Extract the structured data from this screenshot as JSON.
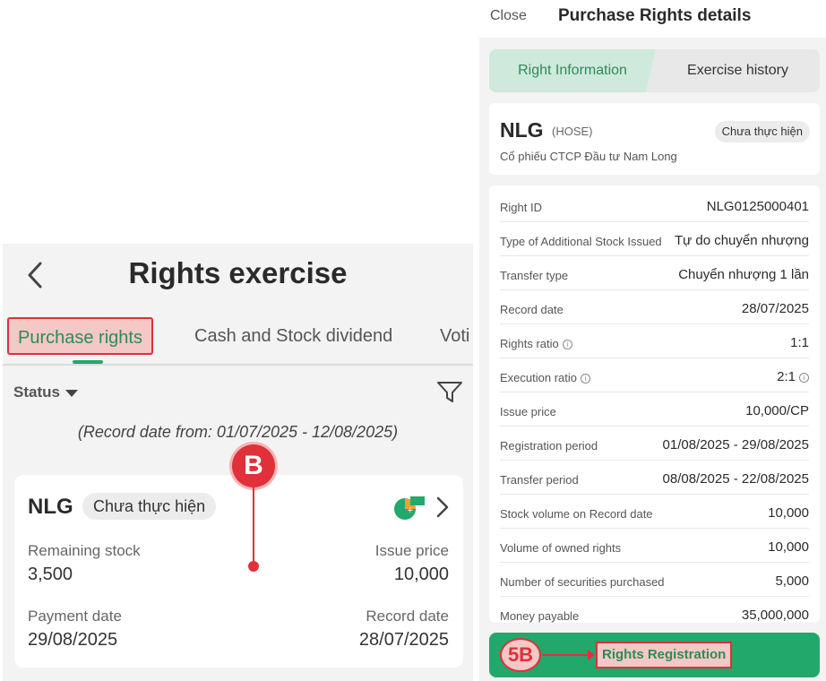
{
  "left": {
    "title": "Rights exercise",
    "back_icon": "chevron-left-icon",
    "tabs": [
      {
        "label": "Purchase rights",
        "active": true
      },
      {
        "label": "Cash and Stock dividend",
        "active": false
      },
      {
        "label": "Voti",
        "active": false
      }
    ],
    "status_label": "Status",
    "filter_icon": "filter-icon",
    "record_date_range": "(Record date from: 01/07/2025 - 12/08/2025)",
    "callout": "B",
    "card": {
      "code": "NLG",
      "status": "Chưa thực hiện",
      "remaining_stock_label": "Remaining stock",
      "remaining_stock_value": "3,500",
      "issue_price_label": "Issue price",
      "issue_price_value": "10,000",
      "payment_date_label": "Payment date",
      "payment_date_value": "29/08/2025",
      "record_date_label": "Record date",
      "record_date_value": "28/07/2025"
    },
    "colors": {
      "accent": "#24a86b",
      "highlight": "#e0303a"
    }
  },
  "right": {
    "close_label": "Close",
    "title": "Purchase Rights details",
    "segments": [
      {
        "label": "Right Information",
        "active": true
      },
      {
        "label": "Exercise history",
        "active": false
      }
    ],
    "stock": {
      "code": "NLG",
      "exchange": "(HOSE)",
      "status": "Chưa thực hiện",
      "name": "Cổ phiếu CTCP Đầu tư Nam Long"
    },
    "rows": [
      {
        "label": "Right ID",
        "value": "NLG0125000401"
      },
      {
        "label": "Type of Additional Stock Issued",
        "value": "Tự do chuyển nhượng"
      },
      {
        "label": "Transfer type",
        "value": "Chuyển nhượng 1 lần"
      },
      {
        "label": "Record date",
        "value": "28/07/2025"
      },
      {
        "label": "Rights ratio",
        "value": "1:1"
      },
      {
        "label": "Execution ratio",
        "value": "2:1"
      },
      {
        "label": "Issue price",
        "value": "10,000/CP"
      },
      {
        "label": "Registration period",
        "value": "01/08/2025 - 29/08/2025"
      },
      {
        "label": "Transfer period",
        "value": "08/08/2025 - 22/08/2025"
      },
      {
        "label": "Stock volume on Record date",
        "value": "10,000"
      },
      {
        "label": "Volume of owned rights",
        "value": "10,000"
      },
      {
        "label": "Number of securities purchased",
        "value": "5,000"
      },
      {
        "label": "Money payable",
        "value": "35,000,000"
      }
    ],
    "info_icon_text": "i",
    "callout": "5B",
    "register_button_label": "Rights Registration",
    "colors": {
      "primary": "#22a86a",
      "highlight": "#e0303a"
    }
  }
}
